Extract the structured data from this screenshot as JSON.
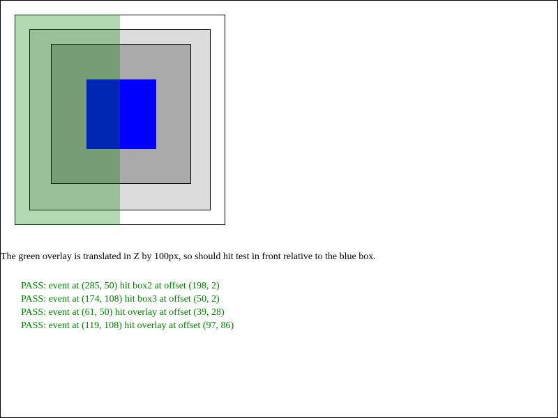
{
  "description": "The green overlay is translated in Z by 100px, so should hit test in front relative to the blue box.",
  "results": [
    "PASS: event at (285, 50) hit box2 at offset (198, 2)",
    "PASS: event at (174, 108) hit box3 at offset (50, 2)",
    "PASS: event at (61, 50) hit overlay at offset (39, 28)",
    "PASS: event at (119, 108) hit overlay at offset (97, 86)"
  ],
  "colors": {
    "overlay": "#008000",
    "blue_box": "#0000ff",
    "box2": "#dcdcdc",
    "box3": "#aaaaaa",
    "pass_text": "#008000"
  }
}
